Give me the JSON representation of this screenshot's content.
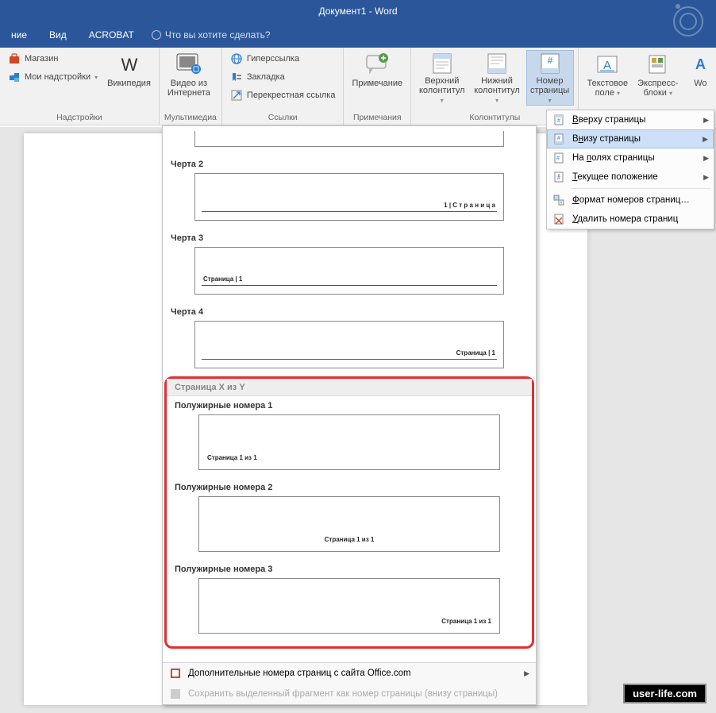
{
  "title": "Документ1 - Word",
  "menu": {
    "tab1": "ние",
    "tab2": "Вид",
    "tab3": "ACROBAT",
    "tellme": "Что вы хотите сделать?"
  },
  "ribbon": {
    "addins": {
      "store": "Магазин",
      "myaddins": "Мои надстройки",
      "wikipedia": "Википедия",
      "label": "Надстройки"
    },
    "media": {
      "video": "Видео из",
      "video2": "Интернета",
      "label": "Мультимедиа"
    },
    "links": {
      "hyperlink": "Гиперссылка",
      "bookmark": "Закладка",
      "crossref": "Перекрестная ссылка",
      "label": "Ссылки"
    },
    "comments": {
      "comment": "Примечание",
      "label": "Примечания"
    },
    "headfoot": {
      "header": "Верхний",
      "header2": "колонтитул",
      "footer": "Нижний",
      "footer2": "колонтитул",
      "pagenum": "Номер",
      "pagenum2": "страницы",
      "label": "Колонтитулы"
    },
    "text": {
      "textbox": "Текстовое",
      "textbox2": "поле",
      "quick": "Экспресс-",
      "quick2": "блоки",
      "wo": "Wo"
    }
  },
  "cm": {
    "top": "Вверху страницы",
    "bottom": "Внизу страницы",
    "margins": "На полях страницы",
    "current": "Текущее положение",
    "format": "Формат номеров страниц…",
    "remove": "Удалить номера страниц"
  },
  "gallery": {
    "line2": "Черта 2",
    "line2txt": "1 | С т р а н и ц а",
    "line3": "Черта 3",
    "line3txt": "Страница | 1",
    "line4": "Черта 4",
    "line4txt": "Страница | 1",
    "cat": "Страница X из Y",
    "bold1": "Полужирные номера 1",
    "bold1txt": "Страница 1 из 1",
    "bold2": "Полужирные номера 2",
    "bold2txt": "Страница 1 из 1",
    "bold3": "Полужирные номера 3",
    "bold3txt": "Страница 1 из 1",
    "more": "Дополнительные номера страниц с сайта Office.com",
    "save": "Сохранить выделенный фрагмент как номер страницы (внизу страницы)"
  },
  "watermark": "user-life.com"
}
